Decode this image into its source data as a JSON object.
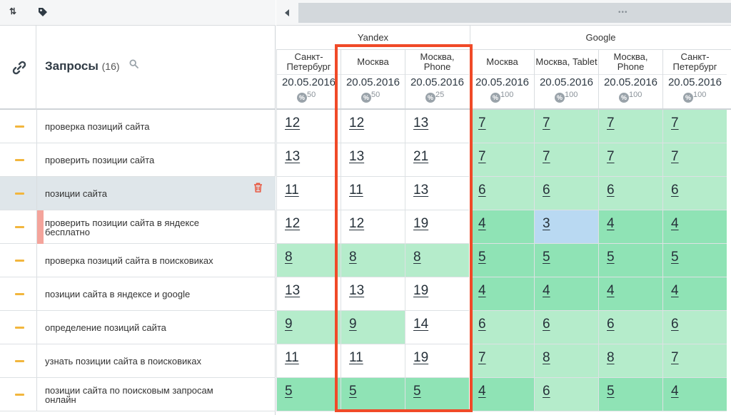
{
  "toolbar": {
    "sort_icon": "⇅",
    "tag_icon": "tag-icon"
  },
  "queries_header": {
    "title": "Запросы",
    "count": "(16)"
  },
  "engines": [
    {
      "name": "Yandex"
    },
    {
      "name": "Google"
    }
  ],
  "columns": [
    {
      "region": "Санкт-Петербург",
      "date": "20.05.2016",
      "percent": "50"
    },
    {
      "region": "Москва",
      "date": "20.05.2016",
      "percent": "50"
    },
    {
      "region": "Москва, Phone",
      "date": "20.05.2016",
      "percent": "25"
    },
    {
      "region": "Москва",
      "date": "20.05.2016",
      "percent": "100"
    },
    {
      "region": "Москва, Tablet",
      "date": "20.05.2016",
      "percent": "100"
    },
    {
      "region": "Москва, Phone",
      "date": "20.05.2016",
      "percent": "100"
    },
    {
      "region": "Санкт-Петербург",
      "date": "20.05.2016",
      "percent": "100"
    }
  ],
  "percent_badge": "%",
  "rows": [
    {
      "query": "проверка позиций сайта",
      "positions": [
        "12",
        "12",
        "13",
        "7",
        "7",
        "7",
        "7"
      ]
    },
    {
      "query": "проверить позиции сайта",
      "positions": [
        "13",
        "13",
        "21",
        "7",
        "7",
        "7",
        "7"
      ]
    },
    {
      "query": "позиции сайта",
      "positions": [
        "11",
        "11",
        "13",
        "6",
        "6",
        "6",
        "6"
      ]
    },
    {
      "query": "проверить позиции сайта в яндексе бесплатно",
      "positions": [
        "12",
        "12",
        "19",
        "4",
        "3",
        "4",
        "4"
      ]
    },
    {
      "query": "проверка позиций сайта в поисковиках",
      "positions": [
        "8",
        "8",
        "8",
        "5",
        "5",
        "5",
        "5"
      ]
    },
    {
      "query": "позиции сайта в яндексе и google",
      "positions": [
        "13",
        "13",
        "19",
        "4",
        "4",
        "4",
        "4"
      ]
    },
    {
      "query": "определение позиций сайта",
      "positions": [
        "9",
        "9",
        "14",
        "6",
        "6",
        "6",
        "6"
      ]
    },
    {
      "query": "узнать позиции сайта в поисковиках",
      "positions": [
        "11",
        "11",
        "19",
        "7",
        "8",
        "8",
        "7"
      ]
    },
    {
      "query": "позиции сайта по поисковым запросам онлайн",
      "positions": [
        "5",
        "5",
        "5",
        "4",
        "6",
        "5",
        "4"
      ]
    }
  ],
  "colors": {
    "top5": "#8fe3b5",
    "top10": "#b5eccb",
    "improved": "#b9d9f2",
    "highlight": "#f04a28",
    "status_dash": "#f2b63d",
    "marker": "#f4a49b"
  }
}
